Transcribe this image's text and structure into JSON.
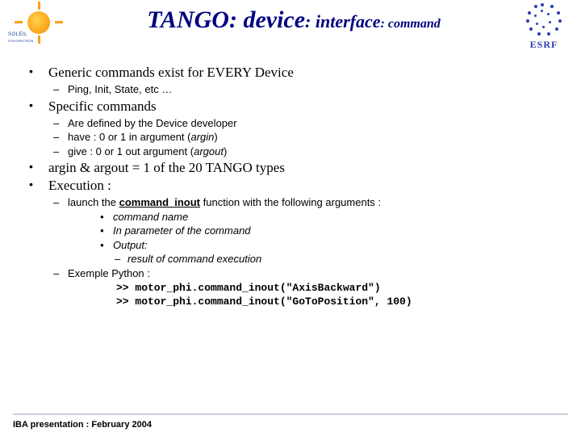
{
  "header": {
    "title_part1": "TANGO: ",
    "title_part2": "device",
    "title_part3": ": interface",
    "title_part4": ": command",
    "logo_left_text": "SOLEIL",
    "logo_left_small": "SYNCHROTRON",
    "logo_right_text": "ESRF"
  },
  "bullets": {
    "b1": "Generic commands exist for EVERY Device",
    "b1_sub1": "Ping, Init, State, etc …",
    "b2": "Specific commands",
    "b2_sub1": "Are defined by the Device developer",
    "b2_sub2_a": "have : 0 or 1 in argument (",
    "b2_sub2_b": "argin",
    "b2_sub2_c": ")",
    "b2_sub3_a": "give : 0 or 1 out argument (",
    "b2_sub3_b": "argout",
    "b2_sub3_c": ")",
    "b3": "argin & argout = 1 of the 20 TANGO types",
    "b4": "Execution :",
    "b4_sub1_a": "launch the ",
    "b4_sub1_b": "command_inout",
    "b4_sub1_c": " function with the following arguments :",
    "b4_lvl3_1": "command name",
    "b4_lvl3_2": "In parameter of the command",
    "b4_lvl3_3": "Output:",
    "b4_lvl4_1": "result of command execution",
    "b4_sub2": "Exemple Python :",
    "code1": ">> motor_phi.command_inout(\"AxisBackward\")",
    "code2": ">> motor_phi.command_inout(\"GoToPosition\", 100)"
  },
  "footer": {
    "text": "IBA presentation : February 2004"
  }
}
